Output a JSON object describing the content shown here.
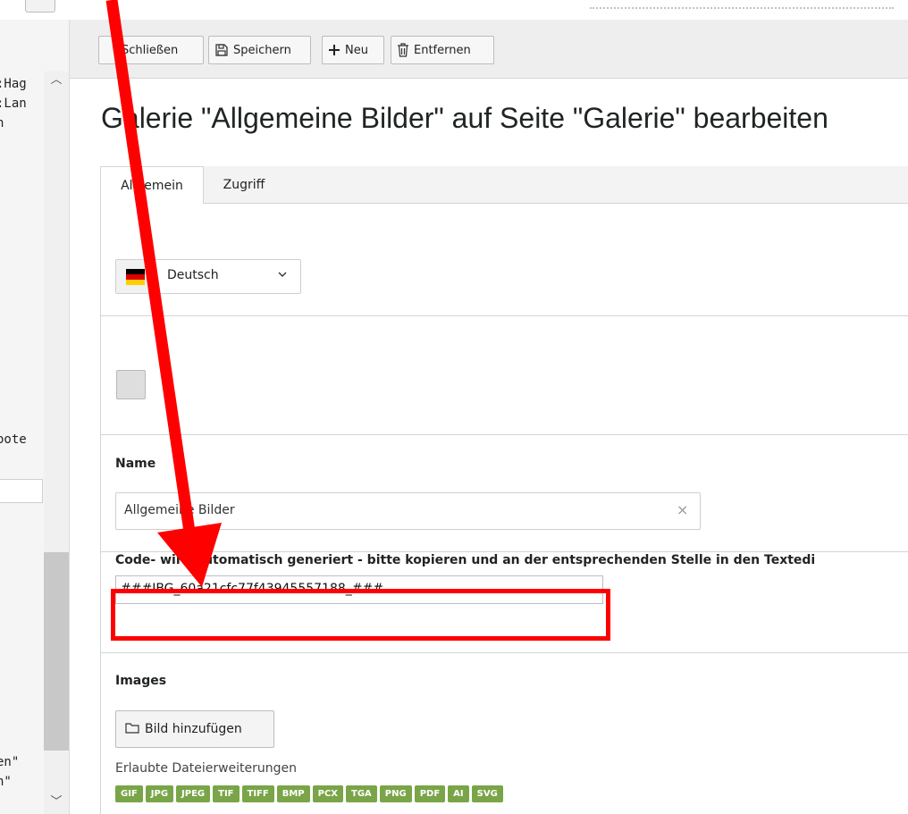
{
  "left_panel": {
    "lines": [
      ":Hag",
      ":Lan",
      "n",
      "oote",
      "en\"",
      "n\""
    ]
  },
  "toolbar": {
    "buttons": [
      {
        "icon": "close-icon",
        "label": "Schließen"
      },
      {
        "icon": "save-icon",
        "label": "Speichern"
      },
      {
        "icon": "plus-icon",
        "label": "Neu"
      },
      {
        "icon": "trash-icon",
        "label": "Entfernen"
      }
    ]
  },
  "page": {
    "title": "Galerie \"Allgemeine Bilder\" auf Seite \"Galerie\" bearbeiten"
  },
  "tabs": [
    {
      "label": "Allgemein",
      "active": true
    },
    {
      "label": "Zugriff",
      "active": false
    }
  ],
  "language": {
    "selected": "Deutsch",
    "flag": "german-flag-icon"
  },
  "form": {
    "name_label": "Name",
    "name_value": "Allgemeine Bilder",
    "clear_glyph": "×",
    "code_label": "Code- wird automatisch generiert - bitte kopieren und an der entsprechenden Stelle in den Textedi",
    "code_value": "###IBG_60a21cfc77f43945557188_###",
    "images_label": "Images",
    "add_image_label": "Bild hinzufügen",
    "allowed_label": "Erlaubte Dateierweiterungen",
    "extensions": [
      "GIF",
      "JPG",
      "JPEG",
      "TIF",
      "TIFF",
      "BMP",
      "PCX",
      "TGA",
      "PNG",
      "PDF",
      "AI",
      "SVG"
    ]
  },
  "colors": {
    "annotation_red": "#ff0000",
    "badge_green": "#79a548"
  }
}
